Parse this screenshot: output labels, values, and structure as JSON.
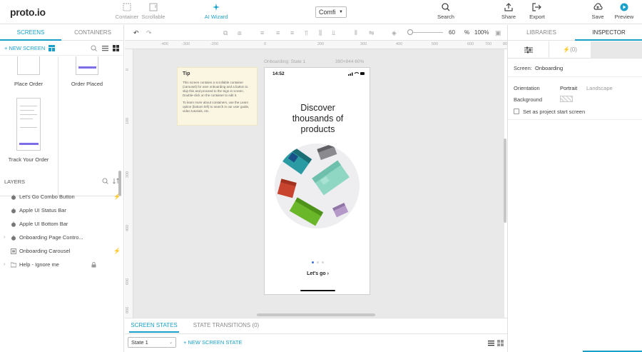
{
  "app": {
    "logo": "proto.io",
    "project_name": "Comfi"
  },
  "toolbar": {
    "container_label": "Container",
    "scrollable_label": "Scrollable",
    "ai_wizard_label": "AI Wizard",
    "search_label": "Search",
    "share_label": "Share",
    "export_label": "Export",
    "save_label": "Save",
    "preview_label": "Preview"
  },
  "left_panel": {
    "tabs": [
      "SCREENS",
      "CONTAINERS"
    ],
    "new_screen": "NEW SCREEN",
    "screens": [
      {
        "label": "Place Order"
      },
      {
        "label": "Order Placed"
      },
      {
        "label": "Track Your Order"
      }
    ],
    "layers_title": "LAYERS",
    "layers": [
      {
        "label": "Let's Go Combo Button",
        "has_chevron": false,
        "interaction": true,
        "locked": false
      },
      {
        "label": "Apple UI Status Bar",
        "has_chevron": false,
        "interaction": false,
        "locked": false
      },
      {
        "label": "Apple UI Bottom Bar",
        "has_chevron": false,
        "interaction": false,
        "locked": false
      },
      {
        "label": "Onboarding Page Contro...",
        "has_chevron": true,
        "interaction": false,
        "locked": false
      },
      {
        "label": "Onboarding Carousel",
        "has_chevron": false,
        "interaction": true,
        "locked": false
      },
      {
        "label": "Help - Ignore me",
        "has_chevron": true,
        "interaction": false,
        "locked": true
      }
    ]
  },
  "editor": {
    "zoom_value": "60",
    "zoom_unit": "%",
    "zoom_reset": "100%",
    "ruler_top": [
      "-400",
      "-300",
      "-200",
      "0",
      "200",
      "300",
      "400",
      "500",
      "600",
      "700",
      "800"
    ],
    "ruler_left": [
      "0",
      "100",
      "200",
      "400",
      "600",
      "800"
    ]
  },
  "canvas": {
    "tip_title": "Tip",
    "tip_body_1": "This screen contains a scrollable container (carousel) for user onboarding and a button to skip this and proceed to the Sign in screen. Double-click on the container to edit it.",
    "tip_body_2": "To learn more about containers, use the Learn option (bottom left) to search in our user guide, video tutorials, etc.",
    "artboard_label": "Onboarding: State 1",
    "artboard_size": "390×844   60%",
    "phone_time": "14:52",
    "headline_1": "Discover",
    "headline_2": "thousands of",
    "headline_3": "products",
    "cta": "Let's go ›"
  },
  "bottom": {
    "tabs": [
      "SCREEN STATES",
      "STATE TRANSITIONS (0)"
    ],
    "state_value": "State 1",
    "new_state": "NEW SCREEN STATE"
  },
  "right_panel": {
    "tabs": [
      "LIBRARIES",
      "INSPECTOR"
    ],
    "interactions_tab": "⚡(0)",
    "screen_label": "Screen:",
    "screen_name": "Onboarding",
    "orientation_label": "Orientation",
    "orientation_portrait": "Portrait",
    "orientation_landscape": "Landscape",
    "background_label": "Background",
    "start_screen_label": "Set as project start screen"
  },
  "colors": {
    "accent": "#1aa0c8",
    "canvas_bg": "#e9e9e9",
    "tip_bg": "#fbf6e2"
  }
}
